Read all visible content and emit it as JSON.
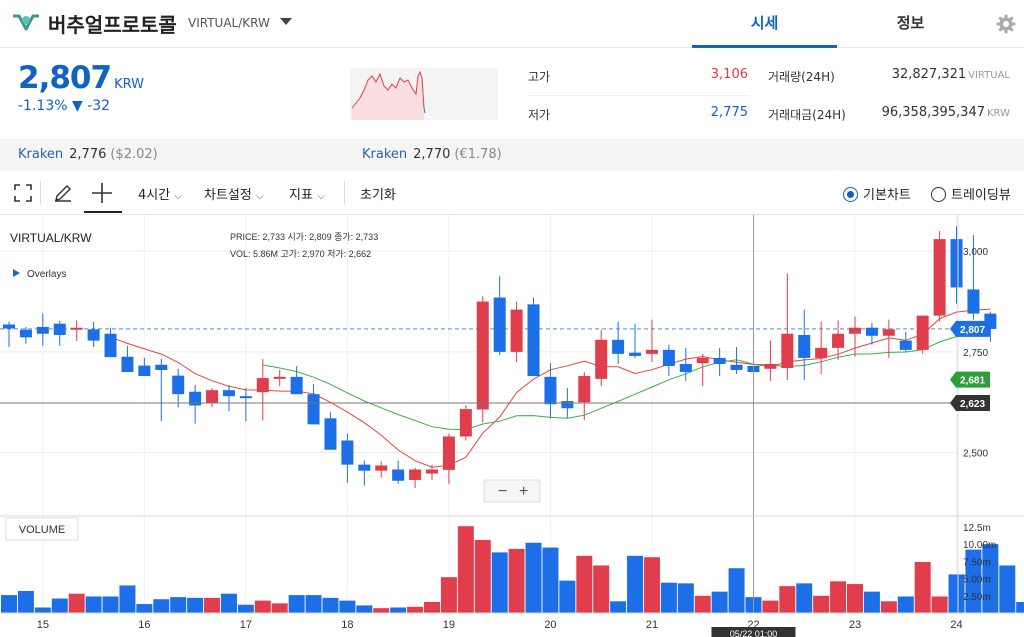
{
  "header": {
    "coin_name": "버추얼프로토콜",
    "symbol": "VIRTUAL/KRW",
    "tabs": [
      {
        "label": "시세"
      },
      {
        "label": "정보"
      }
    ]
  },
  "price": {
    "current": "2,807",
    "unit": "KRW",
    "change_pct": "-1.13%",
    "change_abs": "▼ -32"
  },
  "stats": {
    "high": {
      "label": "고가",
      "value": "3,106"
    },
    "low": {
      "label": "저가",
      "value": "2,775"
    },
    "volume": {
      "label": "거래량(24H)",
      "value": "32,827,321",
      "unit": "VIRTUAL"
    },
    "amount": {
      "label": "거래대금(24H)",
      "value": "96,358,395,347",
      "unit": "KRW"
    }
  },
  "exchanges": [
    {
      "name": "Kraken",
      "price": "2,776",
      "sub": "($2.02)"
    },
    {
      "name": "Kraken",
      "price": "2,770",
      "sub": "(€1.78)"
    }
  ],
  "toolbar": {
    "interval": "4시간",
    "settings": "차트설정",
    "indicator": "지표",
    "reset": "초기화",
    "basic": "기본차트",
    "tradingview": "트레이딩뷰"
  },
  "legend": {
    "pair": "VIRTUAL/KRW",
    "overlays": "Overlays",
    "volume": "VOLUME",
    "price_label": "PRICE:",
    "price": "2,733",
    "open_label": "시가:",
    "open": "2,809",
    "close_label": "종가:",
    "close": "2,733",
    "vol_label": "VOL:",
    "vol": "5.86M",
    "high_label": "고가:",
    "high": "2,970",
    "low_label": "저가:",
    "low": "2,662"
  },
  "colors": {
    "up": "#e03e4c",
    "down": "#1c6fe6",
    "ma_red": "#e0473c",
    "ma_green": "#3cb043",
    "accent": "#1261c4"
  },
  "chart_data": {
    "type": "candlestick",
    "ylim": [
      2345,
      3070
    ],
    "y_ticks": [
      2500,
      2750,
      3000
    ],
    "y_tick_labels": [
      "2,500",
      "2,750",
      "3,000"
    ],
    "x_tick_labels": [
      "15",
      "16",
      "17",
      "18",
      "19",
      "20",
      "21",
      "22",
      "23",
      "24"
    ],
    "x_tick_index": [
      2,
      8,
      14,
      20,
      26,
      32,
      38,
      44,
      50,
      56
    ],
    "price_tags": [
      {
        "value": 2807,
        "label": "2,807",
        "color": "#1c6fe6"
      },
      {
        "value": 2681,
        "label": "2,681",
        "color": "#2e9d3a"
      },
      {
        "value": 2623,
        "label": "2,623",
        "color": "#333333"
      }
    ],
    "crosshair": {
      "index": 44,
      "value": 2623,
      "time_label": "05/22 01:00"
    },
    "candles": [
      {
        "o": 2818,
        "h": 2825,
        "l": 2762,
        "c": 2808
      },
      {
        "o": 2805,
        "h": 2812,
        "l": 2770,
        "c": 2786
      },
      {
        "o": 2812,
        "h": 2845,
        "l": 2765,
        "c": 2795
      },
      {
        "o": 2820,
        "h": 2827,
        "l": 2765,
        "c": 2792
      },
      {
        "o": 2805,
        "h": 2828,
        "l": 2777,
        "c": 2810
      },
      {
        "o": 2806,
        "h": 2825,
        "l": 2762,
        "c": 2778
      },
      {
        "o": 2795,
        "h": 2810,
        "l": 2737,
        "c": 2737
      },
      {
        "o": 2738,
        "h": 2765,
        "l": 2718,
        "c": 2700
      },
      {
        "o": 2716,
        "h": 2735,
        "l": 2705,
        "c": 2690
      },
      {
        "o": 2718,
        "h": 2733,
        "l": 2578,
        "c": 2705
      },
      {
        "o": 2691,
        "h": 2708,
        "l": 2612,
        "c": 2645
      },
      {
        "o": 2651,
        "h": 2668,
        "l": 2572,
        "c": 2617
      },
      {
        "o": 2622,
        "h": 2660,
        "l": 2612,
        "c": 2655
      },
      {
        "o": 2655,
        "h": 2668,
        "l": 2602,
        "c": 2640
      },
      {
        "o": 2640,
        "h": 2660,
        "l": 2578,
        "c": 2638
      },
      {
        "o": 2650,
        "h": 2732,
        "l": 2580,
        "c": 2685
      },
      {
        "o": 2685,
        "h": 2705,
        "l": 2665,
        "c": 2688
      },
      {
        "o": 2688,
        "h": 2715,
        "l": 2645,
        "c": 2645
      },
      {
        "o": 2645,
        "h": 2670,
        "l": 2587,
        "c": 2570
      },
      {
        "o": 2585,
        "h": 2600,
        "l": 2515,
        "c": 2507
      },
      {
        "o": 2530,
        "h": 2547,
        "l": 2425,
        "c": 2470
      },
      {
        "o": 2470,
        "h": 2480,
        "l": 2418,
        "c": 2455
      },
      {
        "o": 2455,
        "h": 2478,
        "l": 2438,
        "c": 2468
      },
      {
        "o": 2458,
        "h": 2480,
        "l": 2422,
        "c": 2430
      },
      {
        "o": 2432,
        "h": 2462,
        "l": 2412,
        "c": 2458
      },
      {
        "o": 2448,
        "h": 2470,
        "l": 2432,
        "c": 2458
      },
      {
        "o": 2457,
        "h": 2547,
        "l": 2422,
        "c": 2540
      },
      {
        "o": 2540,
        "h": 2618,
        "l": 2530,
        "c": 2608
      },
      {
        "o": 2607,
        "h": 2888,
        "l": 2575,
        "c": 2875
      },
      {
        "o": 2885,
        "h": 2938,
        "l": 2742,
        "c": 2750
      },
      {
        "o": 2750,
        "h": 2875,
        "l": 2725,
        "c": 2855
      },
      {
        "o": 2868,
        "h": 2885,
        "l": 2690,
        "c": 2690
      },
      {
        "o": 2688,
        "h": 2722,
        "l": 2585,
        "c": 2620
      },
      {
        "o": 2628,
        "h": 2660,
        "l": 2585,
        "c": 2610
      },
      {
        "o": 2625,
        "h": 2700,
        "l": 2580,
        "c": 2690
      },
      {
        "o": 2683,
        "h": 2805,
        "l": 2665,
        "c": 2780
      },
      {
        "o": 2780,
        "h": 2825,
        "l": 2720,
        "c": 2745
      },
      {
        "o": 2748,
        "h": 2820,
        "l": 2735,
        "c": 2740
      },
      {
        "o": 2745,
        "h": 2830,
        "l": 2725,
        "c": 2755
      },
      {
        "o": 2755,
        "h": 2768,
        "l": 2690,
        "c": 2715
      },
      {
        "o": 2720,
        "h": 2760,
        "l": 2678,
        "c": 2700
      },
      {
        "o": 2722,
        "h": 2745,
        "l": 2665,
        "c": 2735
      },
      {
        "o": 2735,
        "h": 2760,
        "l": 2690,
        "c": 2720
      },
      {
        "o": 2718,
        "h": 2762,
        "l": 2695,
        "c": 2705
      },
      {
        "o": 2715,
        "h": 2785,
        "l": 2680,
        "c": 2700
      },
      {
        "o": 2708,
        "h": 2778,
        "l": 2678,
        "c": 2720
      },
      {
        "o": 2710,
        "h": 2945,
        "l": 2680,
        "c": 2795
      },
      {
        "o": 2792,
        "h": 2855,
        "l": 2680,
        "c": 2735
      },
      {
        "o": 2735,
        "h": 2825,
        "l": 2695,
        "c": 2760
      },
      {
        "o": 2760,
        "h": 2828,
        "l": 2730,
        "c": 2795
      },
      {
        "o": 2795,
        "h": 2838,
        "l": 2738,
        "c": 2810
      },
      {
        "o": 2810,
        "h": 2822,
        "l": 2768,
        "c": 2790
      },
      {
        "o": 2790,
        "h": 2830,
        "l": 2735,
        "c": 2806
      },
      {
        "o": 2778,
        "h": 2800,
        "l": 2750,
        "c": 2755
      },
      {
        "o": 2755,
        "h": 2840,
        "l": 2745,
        "c": 2840
      },
      {
        "o": 2840,
        "h": 3050,
        "l": 2825,
        "c": 3030
      },
      {
        "o": 3030,
        "h": 3062,
        "l": 2870,
        "c": 2910
      },
      {
        "o": 2905,
        "h": 3040,
        "l": 2830,
        "c": 2845
      },
      {
        "o": 2845,
        "h": 2850,
        "l": 2775,
        "c": 2807
      }
    ],
    "volume": {
      "ylim": [
        0,
        13.5
      ],
      "unit": "m",
      "y_tick_labels": [
        "2.50m",
        "5.00m",
        "7.50m",
        "10.00m",
        "12.5m"
      ],
      "values": [
        2.6,
        3.2,
        0.8,
        2.1,
        2.8,
        2.4,
        2.4,
        4.0,
        1.3,
        2.0,
        2.3,
        2.2,
        2.2,
        2.8,
        1.2,
        1.8,
        1.4,
        2.6,
        2.6,
        2.2,
        1.8,
        1.1,
        0.7,
        0.8,
        0.9,
        1.6,
        5.2,
        12.6,
        10.6,
        8.8,
        9.3,
        10.2,
        9.5,
        4.7,
        8.3,
        6.9,
        1.7,
        8.3,
        8.1,
        4.4,
        4.3,
        2.5,
        3.1,
        6.5,
        2.3,
        1.8,
        3.9,
        4.3,
        2.5,
        4.6,
        4.2,
        3.1,
        1.7,
        2.4,
        7.4,
        2.4,
        5.6,
        9.2,
        10.0,
        6.9,
        1.6,
        1.5
      ]
    }
  }
}
